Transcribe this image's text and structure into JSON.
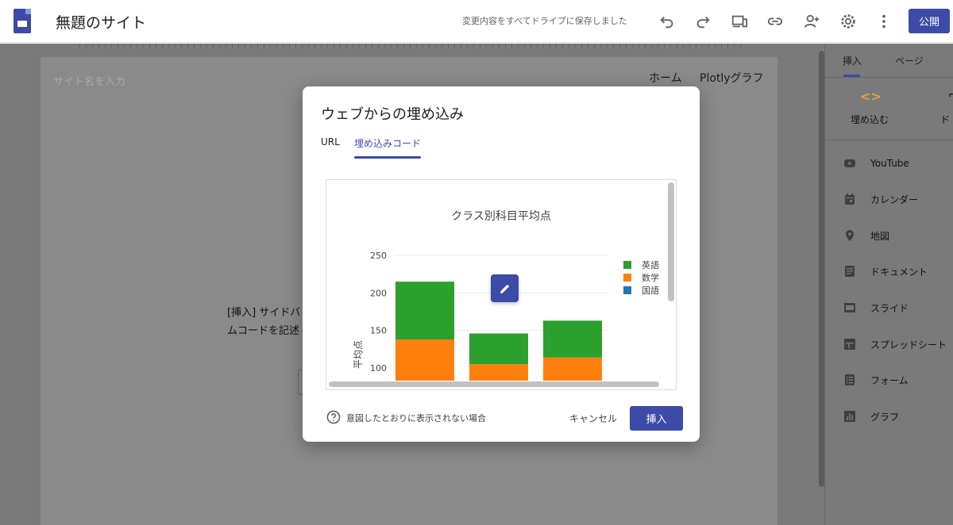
{
  "app": {
    "site_title": "無題のサイト",
    "save_status": "変更内容をすべてドライブに保存しました",
    "publish_label": "公開"
  },
  "canvas": {
    "site_name_placeholder": "サイト名を入力",
    "nav_items": [
      "ホーム",
      "Plotlyグラフ"
    ],
    "body_line1": "[挿入] サイドバ",
    "body_line2": "ムコードを記述"
  },
  "side_panel": {
    "tabs": [
      "挿入",
      "ページ"
    ],
    "embed_label": "埋め込む",
    "embed_icon": "code-brackets-icon",
    "doc_partial_label": "ド",
    "items": [
      {
        "label": "YouTube",
        "icon": "youtube-icon"
      },
      {
        "label": "カレンダー",
        "icon": "calendar-icon"
      },
      {
        "label": "地図",
        "icon": "map-pin-icon"
      },
      {
        "label": "ドキュメント",
        "icon": "document-icon"
      },
      {
        "label": "スライド",
        "icon": "slides-icon"
      },
      {
        "label": "スプレッドシート",
        "icon": "sheets-icon"
      },
      {
        "label": "フォーム",
        "icon": "forms-icon"
      },
      {
        "label": "グラフ",
        "icon": "chart-icon"
      }
    ]
  },
  "dialog": {
    "title": "ウェブからの埋め込み",
    "tabs": [
      "URL",
      "埋め込みコード"
    ],
    "active_tab": 1,
    "help_text": "意図したとおりに表示されない場合",
    "cancel_label": "キャンセル",
    "insert_label": "挿入"
  },
  "colors": {
    "accent": "#3c4aa8",
    "english": "#2ca02c",
    "math": "#ff7f0e",
    "japanese": "#1f77b4"
  },
  "chart_data": {
    "type": "bar",
    "stacked": true,
    "title": "クラス別科目平均点",
    "xlabel": "",
    "ylabel": "平均点",
    "categories": [
      "",
      "",
      ""
    ],
    "ylim_visible": [
      87,
      262
    ],
    "yticks": [
      100,
      150,
      200,
      250
    ],
    "legend_position": "top-right",
    "grid": true,
    "series": [
      {
        "name": "国語",
        "color": "#1f77b4",
        "values": [
          0,
          0,
          0
        ]
      },
      {
        "name": "数学",
        "color": "#ff7f0e",
        "values": [
          138,
          105,
          114
        ]
      },
      {
        "name": "英語",
        "color": "#2ca02c",
        "values": [
          77,
          41,
          49
        ]
      }
    ],
    "legend_order": [
      "英語",
      "数学",
      "国語"
    ]
  }
}
